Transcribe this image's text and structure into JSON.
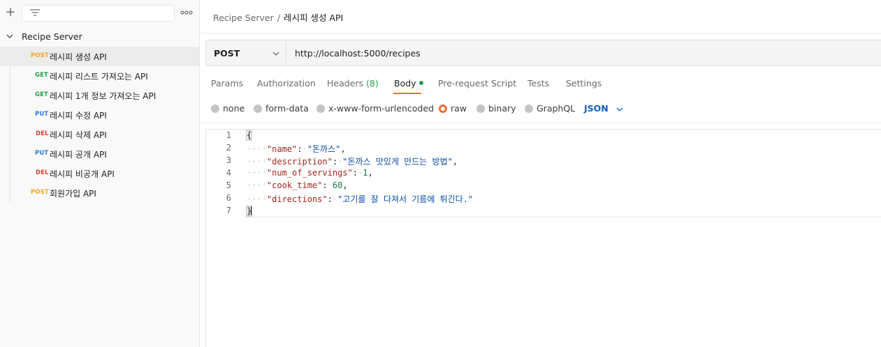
{
  "sidebar": {
    "collection_name": "Recipe Server",
    "items": [
      {
        "method": "POST",
        "label": "레시피 생성 API"
      },
      {
        "method": "GET",
        "label": "레시피 리스트 가져오는 API"
      },
      {
        "method": "GET",
        "label": "레시피 1개 정보 가져오는 API"
      },
      {
        "method": "PUT",
        "label": "레시피 수정 API"
      },
      {
        "method": "DEL",
        "label": "레시피 삭제 API"
      },
      {
        "method": "PUT",
        "label": "레시피 공개 API"
      },
      {
        "method": "DEL",
        "label": "레시피 비공개 API"
      },
      {
        "method": "POST",
        "label": "회원가입 API"
      }
    ]
  },
  "breadcrumb": {
    "parent": "Recipe Server",
    "separator": "/",
    "current": "레시피 생성 API"
  },
  "request": {
    "method": "POST",
    "url": "http://localhost:5000/recipes"
  },
  "tabs": [
    {
      "label": "Params"
    },
    {
      "label": "Authorization"
    },
    {
      "label": "Headers",
      "count": "(8)"
    },
    {
      "label": "Body"
    },
    {
      "label": "Pre-request Script"
    },
    {
      "label": "Tests"
    },
    {
      "label": "Settings"
    }
  ],
  "body_types": [
    "none",
    "form-data",
    "x-www-form-urlencoded",
    "raw",
    "binary",
    "GraphQL"
  ],
  "body_format": "JSON",
  "editor": {
    "line_numbers": [
      "1",
      "2",
      "3",
      "4",
      "5",
      "6",
      "7"
    ],
    "open_brace": "{",
    "close_brace": "}",
    "fields": [
      {
        "key": "\"name\"",
        "value": "\"돈까스\"",
        "trail": ","
      },
      {
        "key": "\"description\"",
        "value": "\"돈까스 맛있게 만드는 방법\"",
        "trail": ","
      },
      {
        "key": "\"num_of_servings\"",
        "value": "1",
        "trail": ","
      },
      {
        "key": "\"cook_time\"",
        "value": "60",
        "trail": ","
      },
      {
        "key": "\"directions\"",
        "value": "\"고기를 잘 다져서 기름에 튀긴다.\"",
        "trail": ""
      }
    ]
  },
  "colors": {
    "accent": "#f26b3a",
    "post": "#f2a61b",
    "get": "#1fa34c",
    "put": "#2f7ad8",
    "del": "#d9432d",
    "link": "#0b5fc4"
  }
}
